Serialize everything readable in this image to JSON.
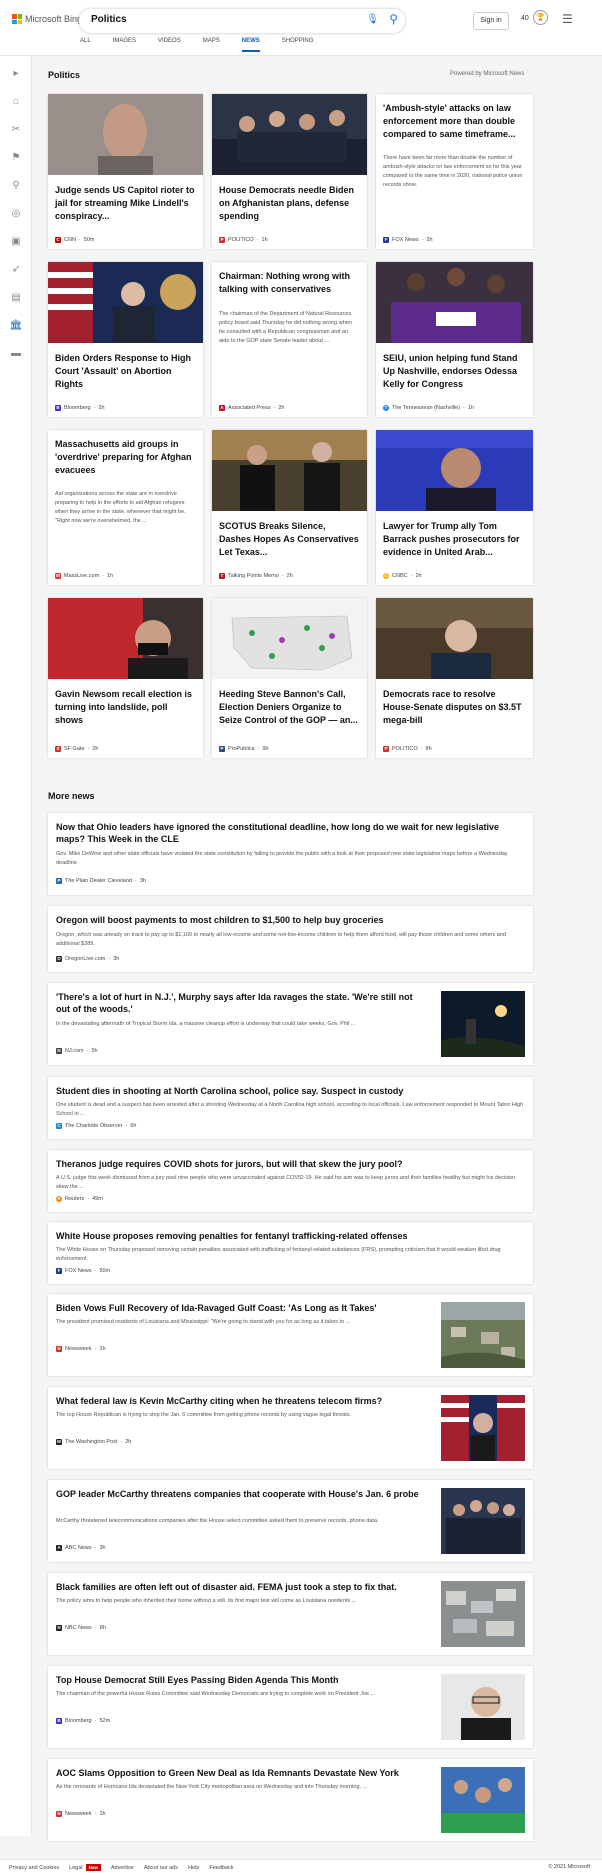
{
  "header": {
    "brand": "Microsoft Bing",
    "query": "Politics",
    "sign_in": "Sign in",
    "points": "40",
    "tabs": [
      "ALL",
      "IMAGES",
      "VIDEOS",
      "MAPS",
      "NEWS",
      "SHOPPING"
    ],
    "active_tab": "NEWS"
  },
  "politics": {
    "title": "Politics",
    "powered": "Powered by Microsoft News",
    "cards": [
      {
        "title": "Judge sends US Capitol rioter to jail for streaming Mike Lindell's conspiracy...",
        "source": "CNN",
        "time": "50m",
        "color": "#cc0000"
      },
      {
        "title": "House Democrats needle Biden on Afghanistan plans, defense spending",
        "source": "POLITICO",
        "time": "1h",
        "color": "#d32f2f"
      },
      {
        "title": "'Ambush-style' attacks on law enforcement more than double compared to same timeframe...",
        "snippet": "There have been far more than double the number of ambush-style attacks on law enforcement so far this year compared to the same time in 2020, national police union records show.",
        "source": "FOX News",
        "time": "2h",
        "color": "#1a3c8c"
      },
      {
        "title": "Biden Orders Response to High Court 'Assault' on Abortion Rights",
        "source": "Bloomberg",
        "time": "2h",
        "color": "#3b2fd6"
      },
      {
        "title": "Chairman: Nothing wrong with talking with conservatives",
        "snippet": "The chairman of the Department of Natural Resources policy board said Thursday he did nothing wrong when he consulted with a Republican congressman and an aide to the GOP state Senate leader about ...",
        "source": "Associated Press",
        "time": "2h",
        "color": "#c8102e"
      },
      {
        "title": "SEIU, union helping fund Stand Up Nashville, endorses Odessa Kelly for Congress",
        "source": "The Tennessean (Nashville)",
        "time": "1h",
        "color": "#1f88e5"
      },
      {
        "title": "Massachusetts aid groups in 'overdrive' preparing for Afghan evacuees",
        "snippet": "Aid organizations across the state are in overdrive preparing to help in the efforts to aid Afghan refugees when they arrive in the state, whenever that might be. \"Right now we're overwhelmed, the ...",
        "source": "MassLive.com",
        "time": "1h",
        "color": "#e53935"
      },
      {
        "title": "SCOTUS Breaks Silence, Dashes Hopes As Conservatives Let Texas...",
        "source": "Talking Points Memo",
        "time": "2h",
        "color": "#b71c1c"
      },
      {
        "title": "Lawyer for Trump ally Tom Barrack pushes prosecutors for evidence in United Arab...",
        "source": "CNBC",
        "time": "2h",
        "color": "#f4b400"
      },
      {
        "title": "Gavin Newsom recall election is turning into landslide, poll shows",
        "source": "SF Gate",
        "time": "2h",
        "color": "#d32f2f"
      },
      {
        "title": "Heeding Steve Bannon's Call, Election Deniers Organize to Seize Control of the GOP — an...",
        "source": "ProPublica",
        "time": "9h",
        "color": "#2e4a7a"
      },
      {
        "title": "Democrats race to resolve House-Senate disputes on $3.5T mega-bill",
        "source": "POLITICO",
        "time": "9h",
        "color": "#d32f2f"
      }
    ]
  },
  "more_news": {
    "title": "More news",
    "items": [
      {
        "title": "Now that Ohio leaders have ignored the constitutional deadline, how long do we wait for new legislative maps? This Week in the CLE",
        "snippet": "Gov. Mike DeWine and other state officials have violated the state constitution by failing to provide the public with a look at their proposed new state legislative maps before a Wednesday deadline.",
        "source": "The Plain Dealer Cleveland",
        "time": "3h",
        "color": "#1e6fb5"
      },
      {
        "title": "Oregon will boost payments to most children to $1,500 to help buy groceries",
        "snippet": "Oregon, which was already on track to pay up to $1,100 to nearly all low-income and some not-low-income children to help them afford food, will pay those children and some others and additional $389.",
        "source": "OregonLive.com",
        "time": "3h",
        "color": "#333333"
      },
      {
        "title": "'There's a lot of hurt in N.J.', Murphy says after Ida ravages the state. 'We're still not out of the woods.'",
        "snippet": "In the devastating aftermath of Tropical Storm Ida, a massive cleanup effort is underway that could take weeks, Gov. Phil ...",
        "source": "NJ.com",
        "time": "5h",
        "color": "#444444"
      },
      {
        "title": "Student dies in shooting at North Carolina school, police say. Suspect in custody",
        "snippet": "One student is dead and a suspect has been arrested after a shooting Wednesday at a North Carolina high school, according to local officials. Law enforcement responded to Mount Tabor High School in ...",
        "source": "The Charlotte Observer",
        "time": "6h",
        "color": "#1e88e5"
      },
      {
        "title": "Theranos judge requires COVID shots for jurors, but will that skew the jury pool?",
        "snippet": "A U.S. judge this week dismissed from a jury pool nine people who were unvaccinated against COVID-19. He said his aim was to keep jurors and their families healthy but might his decision skew the ...",
        "source": "Reuters",
        "time": "49m",
        "color": "#ff8000"
      },
      {
        "title": "White House proposes removing penalties for fentanyl trafficking-related offenses",
        "snippet": "The White House on Thursday proposed removing certain penalties associated with trafficking of fentanyl-related substances (FRS), prompting criticism that it would weaken illicit drug enforcement.",
        "source": "FOX News",
        "time": "50m",
        "color": "#1a3c8c"
      },
      {
        "title": "Biden Vows Full Recovery of Ida-Ravaged Gulf Coast: 'As Long as It Takes'",
        "snippet": "The president promised residents of Louisiana and Mississippi: \"We're going to stand with you for as long as it takes to ...",
        "source": "Newsweek",
        "time": "1h",
        "color": "#d32f2f"
      },
      {
        "title": "What federal law is Kevin McCarthy citing when he threatens telecom firms?",
        "snippet": "The top House Republican is trying to stop the Jan. 6 committee from getting phone records by using vague legal threats.",
        "source": "The Washington Post",
        "time": "2h",
        "color": "#222222"
      },
      {
        "title": "GOP leader McCarthy threatens companies that cooperate with House's Jan. 6 probe",
        "snippet": "McCarthy threatened telecommunications companies after the House select committee asked them to preserve records, phone data.",
        "source": "ABC News",
        "time": "3h",
        "color": "#222222"
      },
      {
        "title": "Black families are often left out of disaster aid. FEMA just took a step to fix that.",
        "snippet": "The policy aims to help people who inherited their home without a will. Its first major test will come as Louisiana residents ...",
        "source": "NBC News",
        "time": "8h",
        "color": "#222222"
      },
      {
        "title": "Top House Democrat Still Eyes Passing Biden Agenda This Month",
        "snippet": "The chairman of the powerful House Rules Committee said Wednesday Democrats are trying to complete work on President Joe ...",
        "source": "Bloomberg",
        "time": "52m",
        "color": "#3b2fd6"
      },
      {
        "title": "AOC Slams Opposition to Green New Deal as Ida Remnants Devastate New York",
        "snippet": "As the remnants of Hurricane Ida devastated the New York City metropolitan area on Wednesday and into Thursday morning, ...",
        "source": "Newsweek",
        "time": "1h",
        "color": "#d32f2f"
      }
    ]
  },
  "footer": {
    "links": [
      "Privacy and Cookies",
      "Legal",
      "Advertise",
      "About our ads",
      "Help",
      "Feedback"
    ],
    "new_badge": "New",
    "copyright": "© 2021 Microsoft"
  }
}
